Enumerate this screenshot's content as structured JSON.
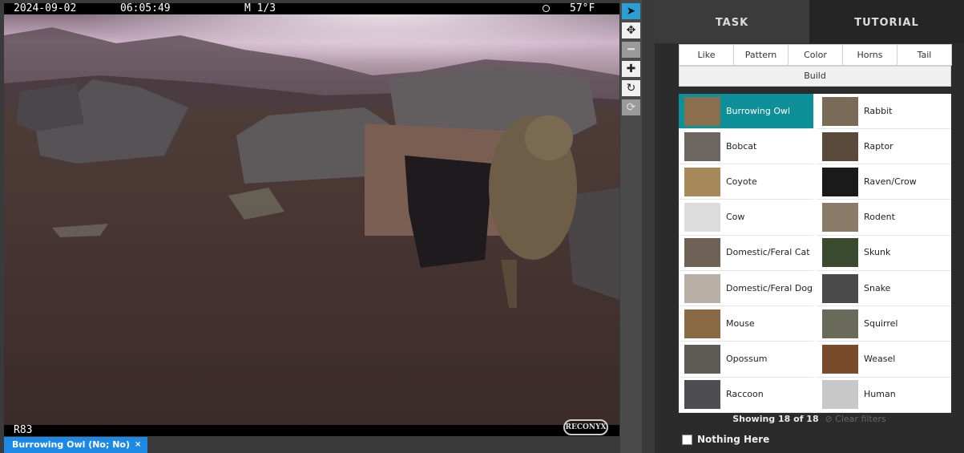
{
  "camera": {
    "date": "2024-09-02",
    "time": "06:05:49",
    "frame": "M 1/3",
    "temperature": "57°F",
    "camera_id": "R83",
    "brand": "RECONYX"
  },
  "selection_tag": {
    "label": "Burrowing Owl (No; No)",
    "remove": "×"
  },
  "toolbar": {
    "tools": [
      {
        "name": "select-tool",
        "glyph": "➤"
      },
      {
        "name": "pan-tool",
        "glyph": "✥"
      },
      {
        "name": "zoom-out-tool",
        "glyph": "━"
      },
      {
        "name": "zoom-in-tool",
        "glyph": "✚"
      },
      {
        "name": "rotate-tool",
        "glyph": "↻"
      },
      {
        "name": "reset-tool",
        "glyph": "⟳"
      }
    ]
  },
  "tabs": {
    "task": "TASK",
    "tutorial": "TUTORIAL"
  },
  "filters": {
    "like": "Like",
    "pattern": "Pattern",
    "color": "Color",
    "horns": "Horns",
    "tail": "Tail",
    "build": "Build"
  },
  "choices": [
    {
      "label": "Burrowing Owl",
      "selected": true,
      "thumb": "#8a6e4e"
    },
    {
      "label": "Rabbit",
      "selected": false,
      "thumb": "#7a6a58"
    },
    {
      "label": "Bobcat",
      "selected": false,
      "thumb": "#6c6660"
    },
    {
      "label": "Raptor",
      "selected": false,
      "thumb": "#5a4a3c"
    },
    {
      "label": "Coyote",
      "selected": false,
      "thumb": "#a88a5a"
    },
    {
      "label": "Raven/Crow",
      "selected": false,
      "thumb": "#1a1a1a"
    },
    {
      "label": "Cow",
      "selected": false,
      "thumb": "#dcdcdc"
    },
    {
      "label": "Rodent",
      "selected": false,
      "thumb": "#8a7a68"
    },
    {
      "label": "Domestic/Feral Cat",
      "selected": false,
      "thumb": "#6e6256"
    },
    {
      "label": "Skunk",
      "selected": false,
      "thumb": "#3a4a2e"
    },
    {
      "label": "Domestic/Feral Dog",
      "selected": false,
      "thumb": "#b8b0a4"
    },
    {
      "label": "Snake",
      "selected": false,
      "thumb": "#4a4a4a"
    },
    {
      "label": "Mouse",
      "selected": false,
      "thumb": "#8a6a44"
    },
    {
      "label": "Squirrel",
      "selected": false,
      "thumb": "#6a6a5a"
    },
    {
      "label": "Opossum",
      "selected": false,
      "thumb": "#5e5a56"
    },
    {
      "label": "Weasel",
      "selected": false,
      "thumb": "#7a4a2a"
    },
    {
      "label": "Raccoon",
      "selected": false,
      "thumb": "#4e4e52"
    },
    {
      "label": "Human",
      "selected": false,
      "thumb": "#c8c8c8"
    }
  ],
  "status": {
    "showing": "Showing 18 of 18",
    "clear_filters": "⊘ Clear filters"
  },
  "nothing_here": {
    "label": "Nothing Here",
    "checked": false
  },
  "colors": {
    "selected": "#0e9098",
    "active_tool": "#2a9fd6",
    "tag": "#1e88e5"
  }
}
